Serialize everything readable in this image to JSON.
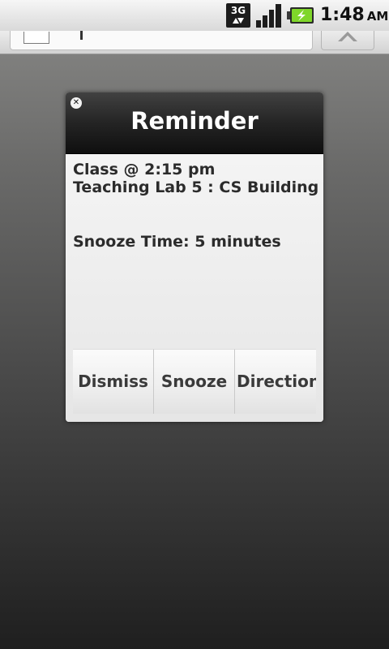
{
  "status_bar": {
    "network_label": "3G",
    "network_icon": "3g-data-icon",
    "signal_icon": "signal-strength-icon",
    "battery_icon": "battery-charging-icon",
    "time": "1:48",
    "ampm": "AM"
  },
  "browser": {
    "page_icon": "page-icon",
    "go_icon": "chevron-up-icon"
  },
  "dialog": {
    "title": "Reminder",
    "close_icon": "close-icon",
    "lines": {
      "event": "Class @ 2:15 pm",
      "location": "Teaching Lab 5 : CS Building",
      "snooze": "Snooze Time: 5 minutes"
    },
    "buttons": {
      "dismiss": "Dismiss",
      "snooze": "Snooze",
      "directions": "Directions"
    }
  },
  "colors": {
    "header_dark": "#0f0f0f",
    "title_text": "#ffffff",
    "body_text": "#2b2b2b",
    "battery_green": "#7fd62a"
  }
}
